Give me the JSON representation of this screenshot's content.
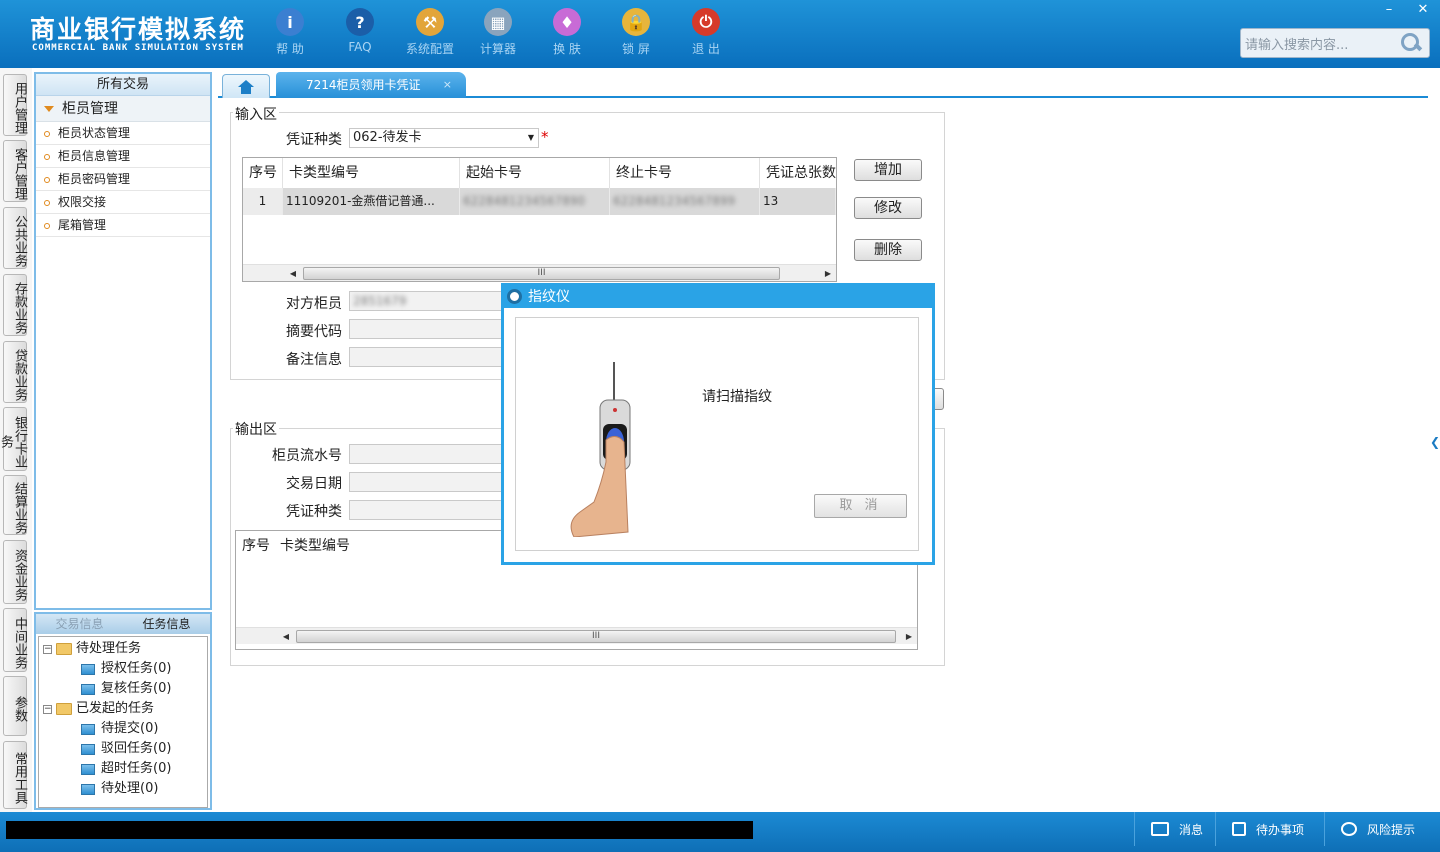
{
  "header": {
    "title_cn": "商业银行模拟系统",
    "title_en": "COMMERCIAL BANK SIMULATION SYSTEM",
    "toolbar": [
      {
        "label": "帮 助",
        "icon": "info-icon",
        "color": "#3b7fd1",
        "glyph": "i"
      },
      {
        "label": "FAQ",
        "icon": "question-icon",
        "color": "#1b5ea8",
        "glyph": "?"
      },
      {
        "label": "系统配置",
        "icon": "toolbox-icon",
        "color": "#e2a53a",
        "glyph": "⚒"
      },
      {
        "label": "计算器",
        "icon": "calculator-icon",
        "color": "#8aa4bd",
        "glyph": "▦"
      },
      {
        "label": "换 肤",
        "icon": "shirt-icon",
        "color": "#c86bd6",
        "glyph": "♦"
      },
      {
        "label": "锁 屏",
        "icon": "lock-icon",
        "color": "#e7b53c",
        "glyph": "🔒"
      },
      {
        "label": "退 出",
        "icon": "power-icon",
        "color": "#d63a2a",
        "glyph": "⏻"
      }
    ],
    "search_placeholder": "请输入搜索内容...",
    "window_controls": {
      "minimize": "–",
      "close": "✕"
    }
  },
  "vertical_tabs": [
    "用户管理",
    "客户管理",
    "公共业务",
    "存款业务",
    "贷款业务",
    "银行卡业务",
    "结算业务",
    "资金业务",
    "中间业务",
    "参数",
    "常用工具"
  ],
  "nav": {
    "header": "所有交易",
    "group": "柜员管理",
    "items": [
      "柜员状态管理",
      "柜员信息管理",
      "柜员密码管理",
      "权限交接",
      "尾箱管理"
    ]
  },
  "task_panel": {
    "tabs": [
      "交易信息",
      "任务信息"
    ],
    "tree": [
      {
        "label": "待处理任务",
        "level": 0
      },
      {
        "label": "授权任务(0)",
        "level": 1
      },
      {
        "label": "复核任务(0)",
        "level": 1
      },
      {
        "label": "已发起的任务",
        "level": 0
      },
      {
        "label": "待提交(0)",
        "level": 1
      },
      {
        "label": "驳回任务(0)",
        "level": 1
      },
      {
        "label": "超时任务(0)",
        "level": 1
      },
      {
        "label": "待处理(0)",
        "level": 1
      }
    ]
  },
  "main_tabs": {
    "active": "7214柜员领用卡凭证",
    "close": "×"
  },
  "input_area": {
    "label": "输入区",
    "voucher_type_label": "凭证种类",
    "voucher_type_value": "062-待发卡",
    "required_mark": "*",
    "grid_headers": [
      "序号",
      "卡类型编号",
      "起始卡号",
      "终止卡号",
      "凭证总张数"
    ],
    "grid_rows": [
      [
        "1",
        "11109201-金燕借记普通...",
        "6228481234567890",
        "6228481234567899",
        "13"
      ]
    ],
    "buttons": {
      "add": "增加",
      "modify": "修改",
      "delete": "删除"
    },
    "counterpart_teller_label": "对方柜员",
    "counterpart_teller_value": "2851679",
    "summary_code_label": "摘要代码",
    "remark_label": "备注信息"
  },
  "output_area": {
    "label": "输出区",
    "teller_serial_label": "柜员流水号",
    "trade_date_label": "交易日期",
    "voucher_type_label": "凭证种类",
    "grid_headers": [
      "序号",
      "卡类型编号"
    ]
  },
  "dialog": {
    "title": "指纹仪",
    "message": "请扫描指纹",
    "cancel": "取 消"
  },
  "status_bar": {
    "message": "消息",
    "todo": "待办事项",
    "risk": "风险提示"
  },
  "scroll_grip": "III"
}
